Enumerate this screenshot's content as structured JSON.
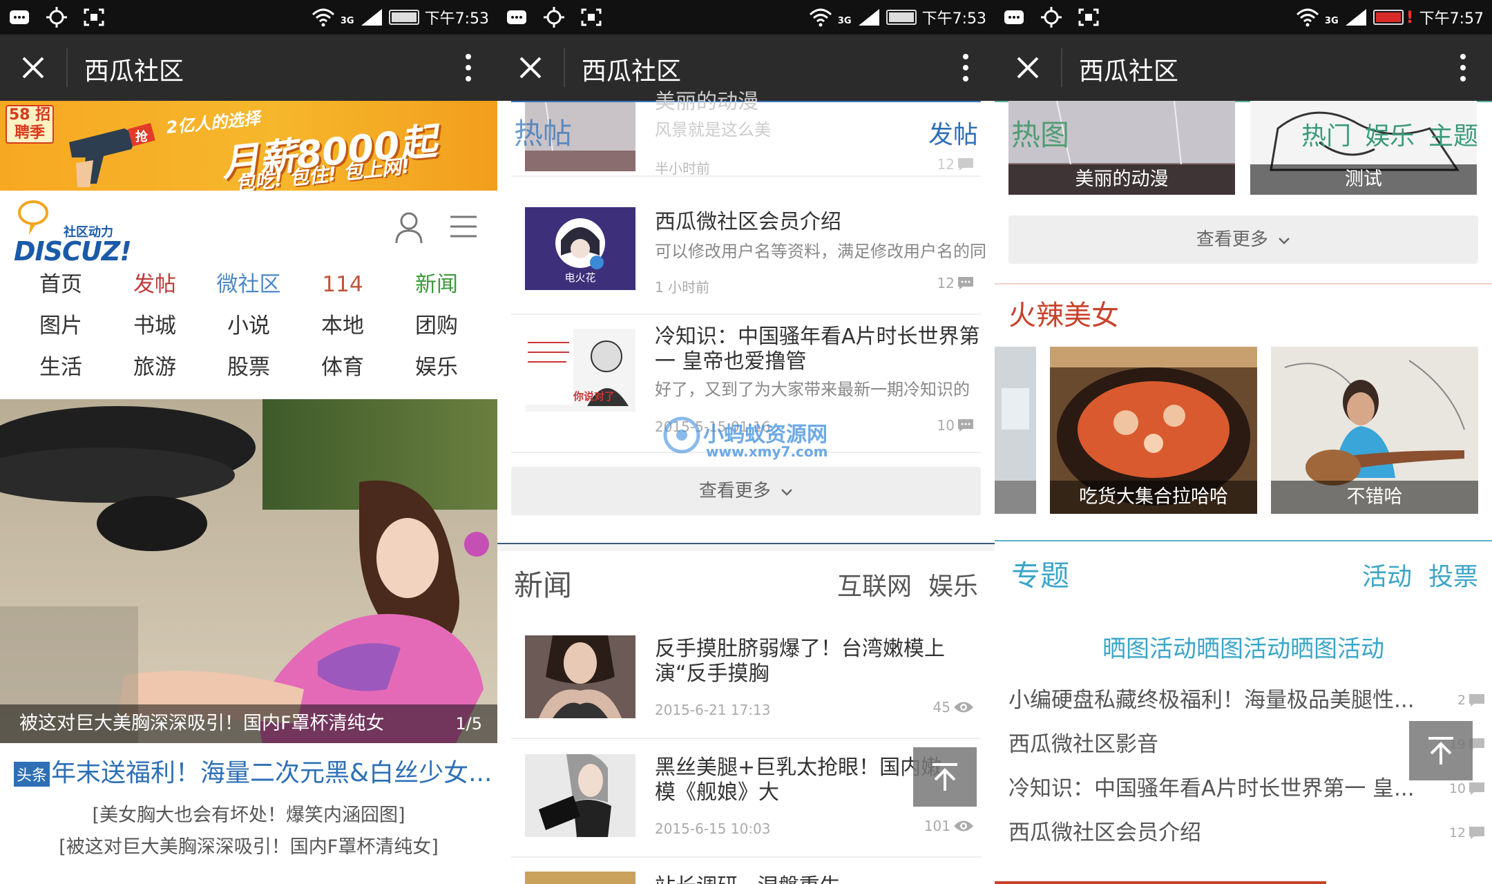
{
  "status_bars": [
    {
      "time": "下午7:53",
      "network": "3G",
      "battery": "full"
    },
    {
      "time": "下午7:53",
      "network": "3G",
      "battery": "full"
    },
    {
      "time": "下午7:57",
      "network": "3G",
      "battery": "low"
    }
  ],
  "app_title": "西瓜社区",
  "screen1": {
    "banner": {
      "tag": "58 招聘季",
      "line1": "2亿人的选择",
      "line2": "月薪8000起",
      "line3": "包吃! 包住! 包上网!",
      "grab": "抢"
    },
    "logo": {
      "tagline": "社区动力",
      "brand": "DISCUZ!"
    },
    "nav": [
      {
        "label": "首页",
        "color": "#333333"
      },
      {
        "label": "发帖",
        "color": "#c03a3a"
      },
      {
        "label": "微社区",
        "color": "#4a88c8"
      },
      {
        "label": "114",
        "color": "#c0553a"
      },
      {
        "label": "新闻",
        "color": "#3a9a3a"
      },
      {
        "label": "图片",
        "color": "#333333"
      },
      {
        "label": "书城",
        "color": "#333333"
      },
      {
        "label": "小说",
        "color": "#333333"
      },
      {
        "label": "本地",
        "color": "#333333"
      },
      {
        "label": "团购",
        "color": "#333333"
      },
      {
        "label": "生活",
        "color": "#333333"
      },
      {
        "label": "旅游",
        "color": "#333333"
      },
      {
        "label": "股票",
        "color": "#333333"
      },
      {
        "label": "体育",
        "color": "#333333"
      },
      {
        "label": "娱乐",
        "color": "#333333"
      }
    ],
    "hero": {
      "caption": "被这对巨大美胸深深吸引！国内F罩杯清纯女",
      "pager": "1/5"
    },
    "headline": {
      "badge": "头条",
      "text": "年末送福利！海量二次元黑&白丝少女..."
    },
    "sublinks": [
      "[美女胸大也会有坏处！爆笑内涵囧图]",
      "[被这对巨大美胸深深吸引！国内F罩杯清纯女]"
    ]
  },
  "screen2": {
    "hot": {
      "title": "热帖",
      "action": "发帖",
      "faded_title": "美丽的动漫",
      "faded_desc": "风景就是这么美",
      "faded_time": "半小时前",
      "faded_count": "12"
    },
    "posts": [
      {
        "title": "西瓜微社区会员介绍",
        "desc": "可以修改用户名等资料，满足修改用户名的同",
        "time": "1 小时前",
        "count": "12",
        "thumb_label": "电火花"
      },
      {
        "title": "冷知识：中国骚年看A片时长世界第一 皇帝也爱撸管",
        "desc": "好了，又到了为大家带来最新一期冷知识的",
        "time": "2015-5-15 01:16",
        "count": "10",
        "thumb_label": "你说对了"
      }
    ],
    "more": "查看更多",
    "news": {
      "title": "新闻",
      "tabs": [
        "互联网",
        "娱乐"
      ]
    },
    "news_items": [
      {
        "title": "反手摸肚脐弱爆了！台湾嫩模上演“反手摸胸",
        "time": "2015-6-21 17:13",
        "views": "45"
      },
      {
        "title": "黑丝美腿+巨乳太抢眼！国内嫩模《舰娘》大",
        "time": "2015-6-15 10:03",
        "views": "101"
      }
    ],
    "next_title": "站长调研 · 涅槃重生"
  },
  "screen3": {
    "hot_images": {
      "title": "热图",
      "tabs": [
        "热门",
        "娱乐",
        "主题"
      ],
      "items": [
        {
          "caption": "美丽的动漫"
        },
        {
          "caption": "测试"
        }
      ]
    },
    "more": "查看更多",
    "beauty": {
      "title": "火辣美女",
      "items": [
        {
          "caption": "吃货大集合拉哈哈"
        },
        {
          "caption": "不错哈"
        }
      ]
    },
    "topics": {
      "title": "专题",
      "tabs": [
        "活动",
        "投票"
      ],
      "featured": "晒图活动晒图活动晒图活动",
      "items": [
        {
          "title": "小编硬盘私藏终极福利！海量极品美腿性...",
          "count": "2"
        },
        {
          "title": "西瓜微社区影音",
          "count": "19"
        },
        {
          "title": "冷知识：中国骚年看A片时长世界第一 皇...",
          "count": "10"
        },
        {
          "title": "西瓜微社区会员介绍",
          "count": "12"
        }
      ]
    }
  },
  "watermark": {
    "cn": "小蚂蚁资源网",
    "url": "www.xmy7.com"
  },
  "colors": {
    "accent_blue": "#2e6fb5",
    "teal": "#3aa5c8",
    "red": "#c9422b",
    "titlebar": "#2b2b2b"
  }
}
